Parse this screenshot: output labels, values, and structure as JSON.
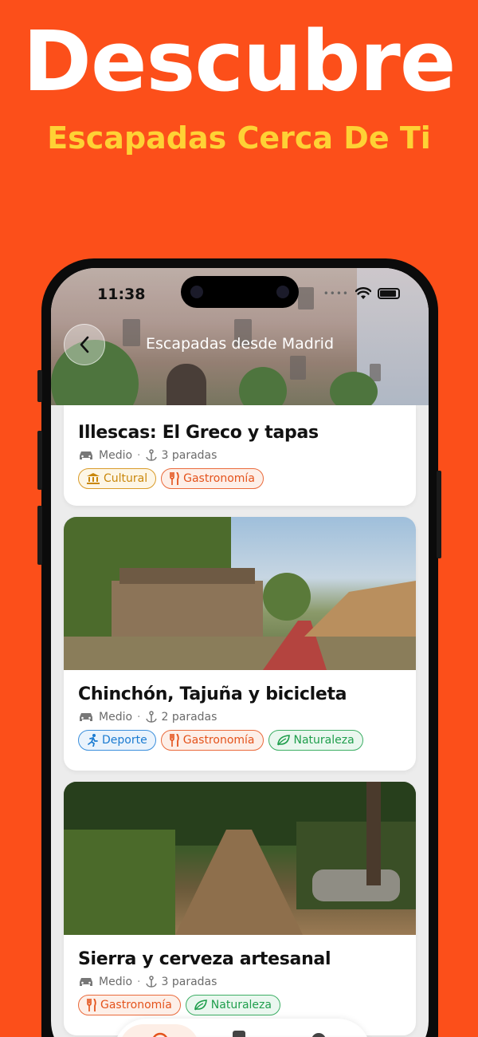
{
  "hero": {
    "title": "Descubre",
    "subtitle": "Escapadas Cerca De Ti"
  },
  "status_bar": {
    "time": "11:38"
  },
  "header": {
    "title": "Escapadas desde Madrid"
  },
  "cards": [
    {
      "title": "Illescas: El Greco y tapas",
      "difficulty": "Medio",
      "stops": "3 paradas",
      "tags": [
        "Cultural",
        "Gastronomía"
      ]
    },
    {
      "title": "Chinchón, Tajuña y bicicleta",
      "difficulty": "Medio",
      "stops": "2 paradas",
      "tags": [
        "Deporte",
        "Gastronomía",
        "Naturaleza"
      ]
    },
    {
      "title": "Sierra y cerveza artesanal",
      "difficulty": "Medio",
      "stops": "3 paradas",
      "tags": [
        "Gastronomía",
        "Naturaleza"
      ]
    }
  ],
  "colors": {
    "background": "#fc4f1a",
    "subtitle": "#fed235",
    "cultural": "#c9870b",
    "gastronomia": "#e4531c",
    "deporte": "#1b7bd1",
    "naturaleza": "#1f9e4c"
  },
  "icons": {
    "back": "chevron-left-icon",
    "transport": "car-icon",
    "stops": "anchor-icon",
    "cultural": "museum-icon",
    "gastronomia": "fork-knife-icon",
    "deporte": "running-icon",
    "naturaleza": "leaf-icon"
  }
}
